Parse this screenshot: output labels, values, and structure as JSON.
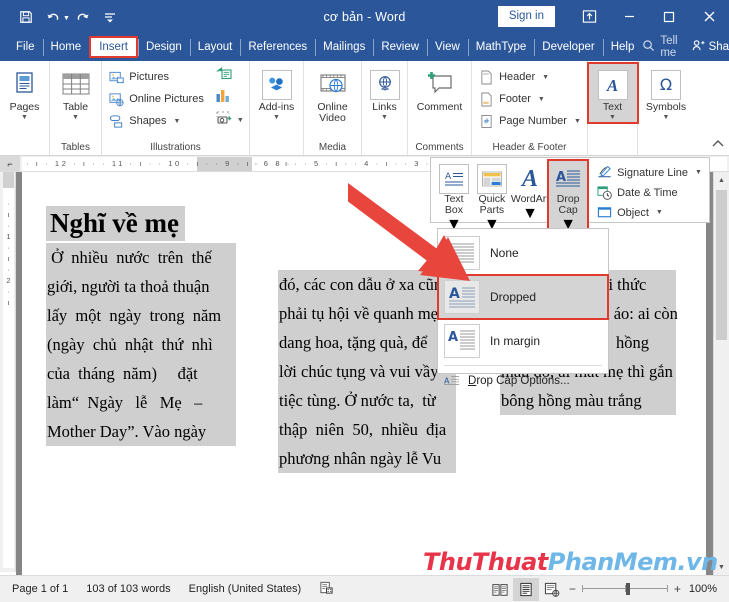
{
  "window": {
    "title": "cơ bản  -  Word",
    "signin_label": "Sign in",
    "quick_access": [
      "save-icon",
      "undo-icon",
      "redo-icon",
      "customize-qat-icon"
    ],
    "ribbon_display_options": "ribbon-display-options-icon",
    "minimize": "minimize-icon",
    "maximize": "maximize-icon",
    "close": "close-icon"
  },
  "tabs": [
    {
      "label": "File",
      "active": false
    },
    {
      "label": "Home",
      "active": false
    },
    {
      "label": "Insert",
      "active": true
    },
    {
      "label": "Design",
      "active": false
    },
    {
      "label": "Layout",
      "active": false
    },
    {
      "label": "References",
      "active": false
    },
    {
      "label": "Mailings",
      "active": false
    },
    {
      "label": "Review",
      "active": false
    },
    {
      "label": "View",
      "active": false
    },
    {
      "label": "MathType",
      "active": false
    },
    {
      "label": "Developer",
      "active": false
    },
    {
      "label": "Help",
      "active": false
    }
  ],
  "tab_right": {
    "tell_me": "Tell me",
    "share": "Share"
  },
  "ribbon": {
    "groups": [
      {
        "name": "Pages",
        "label": "",
        "buttons": [
          {
            "label": "Pages",
            "caret": true
          }
        ]
      },
      {
        "name": "Tables",
        "label": "Tables",
        "buttons": [
          {
            "label": "Table",
            "caret": true
          }
        ]
      },
      {
        "name": "Illustrations",
        "label": "Illustrations",
        "items": [
          {
            "label": "Pictures",
            "caret": false
          },
          {
            "label": "Online Pictures",
            "caret": false
          },
          {
            "label": "Shapes",
            "caret": true
          }
        ],
        "extra": [
          "smartart-icon",
          "chart-icon",
          "screenshot-icon"
        ]
      },
      {
        "name": "Media-Addins",
        "label": "",
        "buttons": [
          {
            "label": "Add-ins",
            "caret": true
          }
        ]
      },
      {
        "name": "Media",
        "label": "Media",
        "buttons": [
          {
            "label": "Online Video",
            "caret": false
          }
        ]
      },
      {
        "name": "Links",
        "label": "",
        "buttons": [
          {
            "label": "Links",
            "caret": true
          }
        ]
      },
      {
        "name": "Comments",
        "label": "Comments",
        "buttons": [
          {
            "label": "Comment",
            "caret": false
          }
        ]
      },
      {
        "name": "HeaderFooter",
        "label": "Header & Footer",
        "items": [
          {
            "label": "Header",
            "caret": true
          },
          {
            "label": "Footer",
            "caret": true
          },
          {
            "label": "Page Number",
            "caret": true
          }
        ]
      },
      {
        "name": "Text",
        "label": "",
        "buttons": [
          {
            "label": "Text",
            "caret": true,
            "highlighted": true
          }
        ]
      },
      {
        "name": "Symbols",
        "label": "",
        "buttons": [
          {
            "label": "Symbols",
            "caret": true
          }
        ]
      }
    ],
    "collapse_icon": "collapse-ribbon-icon"
  },
  "text_panel": {
    "buttons": [
      {
        "label": "Text Box",
        "caret": true,
        "highlighted": false
      },
      {
        "label": "Quick Parts",
        "caret": true,
        "highlighted": false
      },
      {
        "label": "WordArt",
        "caret": true,
        "highlighted": false
      },
      {
        "label": "Drop Cap",
        "caret": true,
        "highlighted": true
      }
    ],
    "right_items": [
      {
        "label": "Signature Line",
        "caret": true
      },
      {
        "label": "Date & Time",
        "caret": false
      },
      {
        "label": "Object",
        "caret": true
      }
    ]
  },
  "drop_cap_menu": {
    "items": [
      {
        "label": "None",
        "selected": false
      },
      {
        "label": "Dropped",
        "selected": true
      },
      {
        "label": "In margin",
        "selected": false
      }
    ],
    "options_label_pre": "D",
    "options_label_post": "rop Cap Options..."
  },
  "ruler": {
    "tab_selector": "left-tab-icon",
    "marks": "· ı · 12 · ı · · 11 · ı · · 10 · ı · · 9 · ı · · 8 ·",
    "marks_right": "· 6 · ı · · 5 · ı · · 4 · ı · · 3 · ı · ·",
    "vertical_marks": [
      "·",
      "ı",
      "·",
      "1",
      "·",
      "ı",
      "·",
      "2",
      "·",
      "ı"
    ]
  },
  "document": {
    "title": "Nghĩ về mẹ",
    "column1": [
      " Ở  nhiều  nước  trên  thế",
      "giới, người ta thoả thuận",
      "lấy  một  ngày  trong  năm",
      "(ngày  chủ  nhật  thứ  nhì",
      "của  tháng  năm)     đặt",
      "làm“  Ngày   lễ   Mẹ   –",
      "Mother Day”. Vào ngày"
    ],
    "column2": [
      "đó, các con dẫu ở xa cũng",
      "phải tụ hội về quanh mẹ,",
      "dang hoa, tặng quà, để",
      "lời chúc tụng và vui vầy",
      "tiệc tùng. Ở nước ta,  từ",
      "thập  niên  50,  nhiều  địa",
      "phương nhân ngày lễ Vu"
    ],
    "column3": [
      "Lan tổ chức nghi thức",
      "cài hoa hồng lên áo: ai còn",
      "mẹ thì gắn bông  hồng",
      "màu đỏ, ai mất mẹ thì gắn",
      "bông hồng màu trắng"
    ]
  },
  "watermark": {
    "part1": "ThuThuat",
    "part2": "PhanMem.vn",
    "color1": "#e8344a",
    "color2": "#6fb7e8"
  },
  "status_bar": {
    "page": "Page 1 of 1",
    "words": "103 of 103 words",
    "language": "English (United States)",
    "proofing_icon": "proofing-errors-icon",
    "views": [
      {
        "name": "read-mode-icon",
        "active": false
      },
      {
        "name": "print-layout-icon",
        "active": true
      },
      {
        "name": "web-layout-icon",
        "active": false
      }
    ],
    "zoom_out": "−",
    "zoom_in": "+",
    "zoom_level": "100%"
  }
}
